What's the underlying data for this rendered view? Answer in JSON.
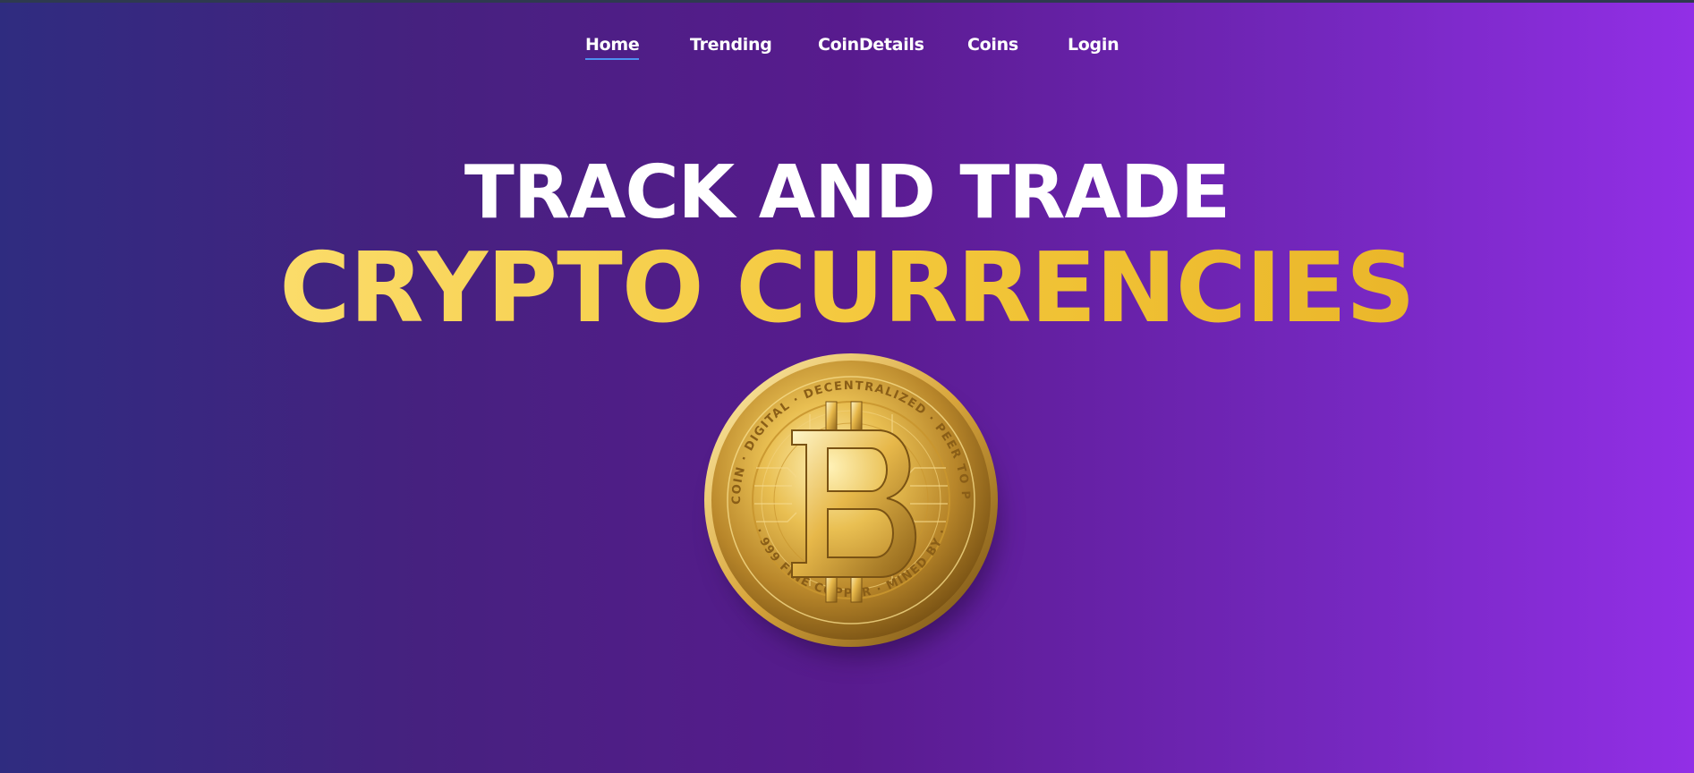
{
  "nav": {
    "items": [
      {
        "label": "Home",
        "active": true
      },
      {
        "label": "Trending",
        "active": false
      },
      {
        "label": "CoinDetails",
        "active": false
      },
      {
        "label": "Coins",
        "active": false
      },
      {
        "label": "Login",
        "active": false
      }
    ]
  },
  "hero": {
    "headline": "TRACK AND TRADE",
    "highlight": "CRYPTO CURRENCIES",
    "coin": {
      "icon": "bitcoin-coin-icon",
      "inscription_top": "BITCOIN · DIGITAL · DECENTRALIZED · PEER TO PEER",
      "inscription_bottom": "· 999 FINE COPPER · MINED BY ·"
    }
  },
  "colors": {
    "background_start": "#2f2c80",
    "background_end": "#922fe6",
    "headline": "#ffffff",
    "highlight": "#f3c73a",
    "nav_underline": "#4e8ff0"
  }
}
